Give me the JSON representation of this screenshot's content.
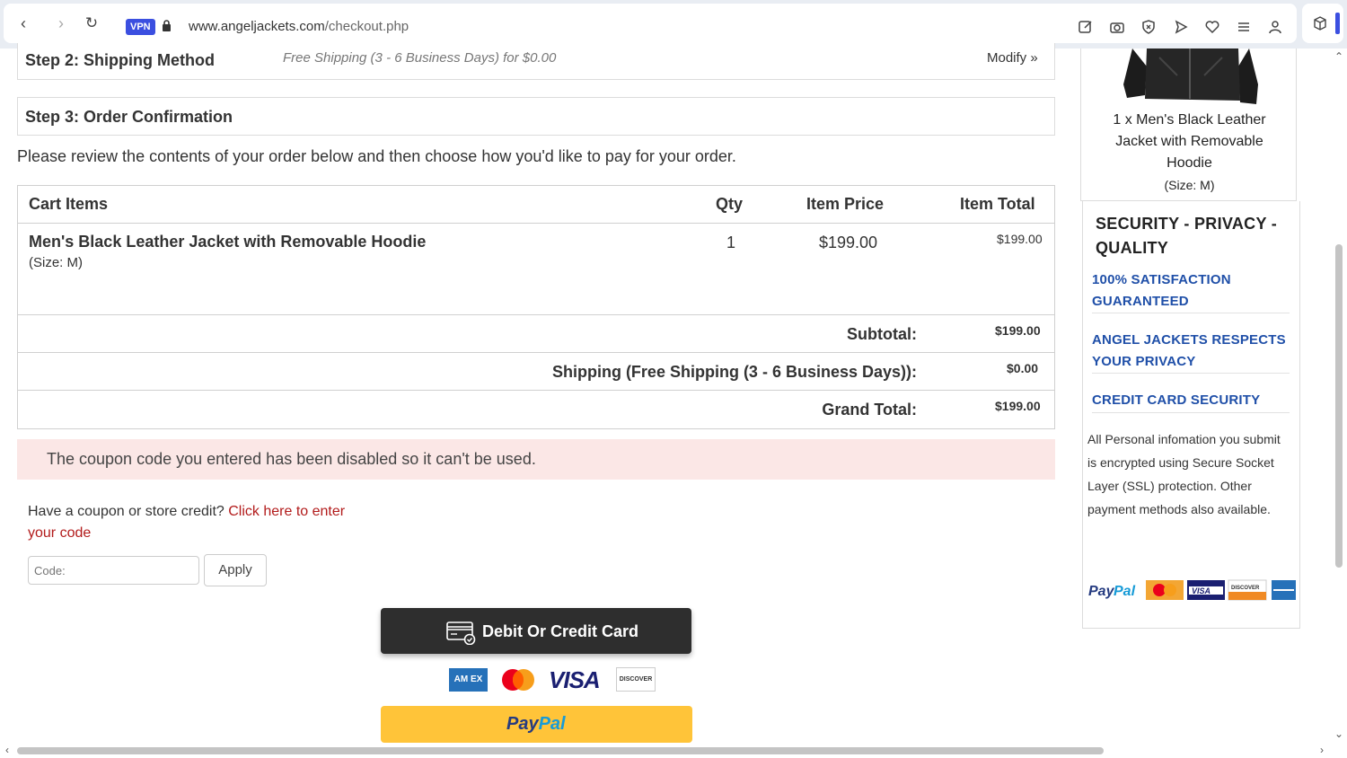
{
  "browser": {
    "vpn_label": "VPN",
    "url_host": "www.angeljackets.com",
    "url_path": "/checkout.php"
  },
  "step2": {
    "title": "Step 2: Shipping Method",
    "method": "Free Shipping (3 - 6 Business Days) for $0.00",
    "modify_link": "Modify »"
  },
  "step3": {
    "title": "Step 3: Order Confirmation",
    "intro": "Please review the contents of your order below and then choose how you'd like to pay for your order."
  },
  "cart": {
    "headers": {
      "items": "Cart Items",
      "qty": "Qty",
      "price": "Item Price",
      "total": "Item Total"
    },
    "item": {
      "name": "Men's Black Leather Jacket with Removable Hoodie",
      "size": "(Size: M)",
      "qty": "1",
      "price": "$199.00",
      "total": "$199.00"
    },
    "subtotal_label": "Subtotal:",
    "subtotal_value": "$199.00",
    "shipping_label": "Shipping (Free Shipping (3 - 6 Business Days)):",
    "shipping_value": "$0.00",
    "grand_label": "Grand Total:",
    "grand_value": "$199.00"
  },
  "alert": {
    "message": "The coupon code you entered has been disabled so it can't be used."
  },
  "coupon": {
    "prompt": "Have a coupon or store credit?",
    "link": "Click here to enter your code",
    "placeholder": "Code:",
    "apply_label": "Apply"
  },
  "payment": {
    "card_button": "Debit Or Credit Card",
    "amex": "AM EX",
    "visa": "VISA",
    "discover": "DISCOVER",
    "paypal_part1": "Pay",
    "paypal_part2": "Pal"
  },
  "sidebar": {
    "product_line1": "1 x Men's Black Leather Jacket with Removable Hoodie",
    "product_size": "(Size: M)",
    "security_title": "SECURITY - PRIVACY - QUALITY",
    "links": [
      "100% SATISFACTION GUARANTEED",
      "ANGEL JACKETS RESPECTS YOUR PRIVACY",
      "CREDIT CARD SECURITY"
    ],
    "security_text": "All Personal infomation you submit is encrypted using Secure Socket Layer (SSL) protection. Other payment methods also available."
  },
  "colors": {
    "link_blue": "#1f4fa8",
    "alert_bg": "#fbe7e6",
    "coupon_link": "#b21b1b",
    "paypal_yellow": "#ffc439",
    "card_button_bg": "#2e2e2e"
  }
}
